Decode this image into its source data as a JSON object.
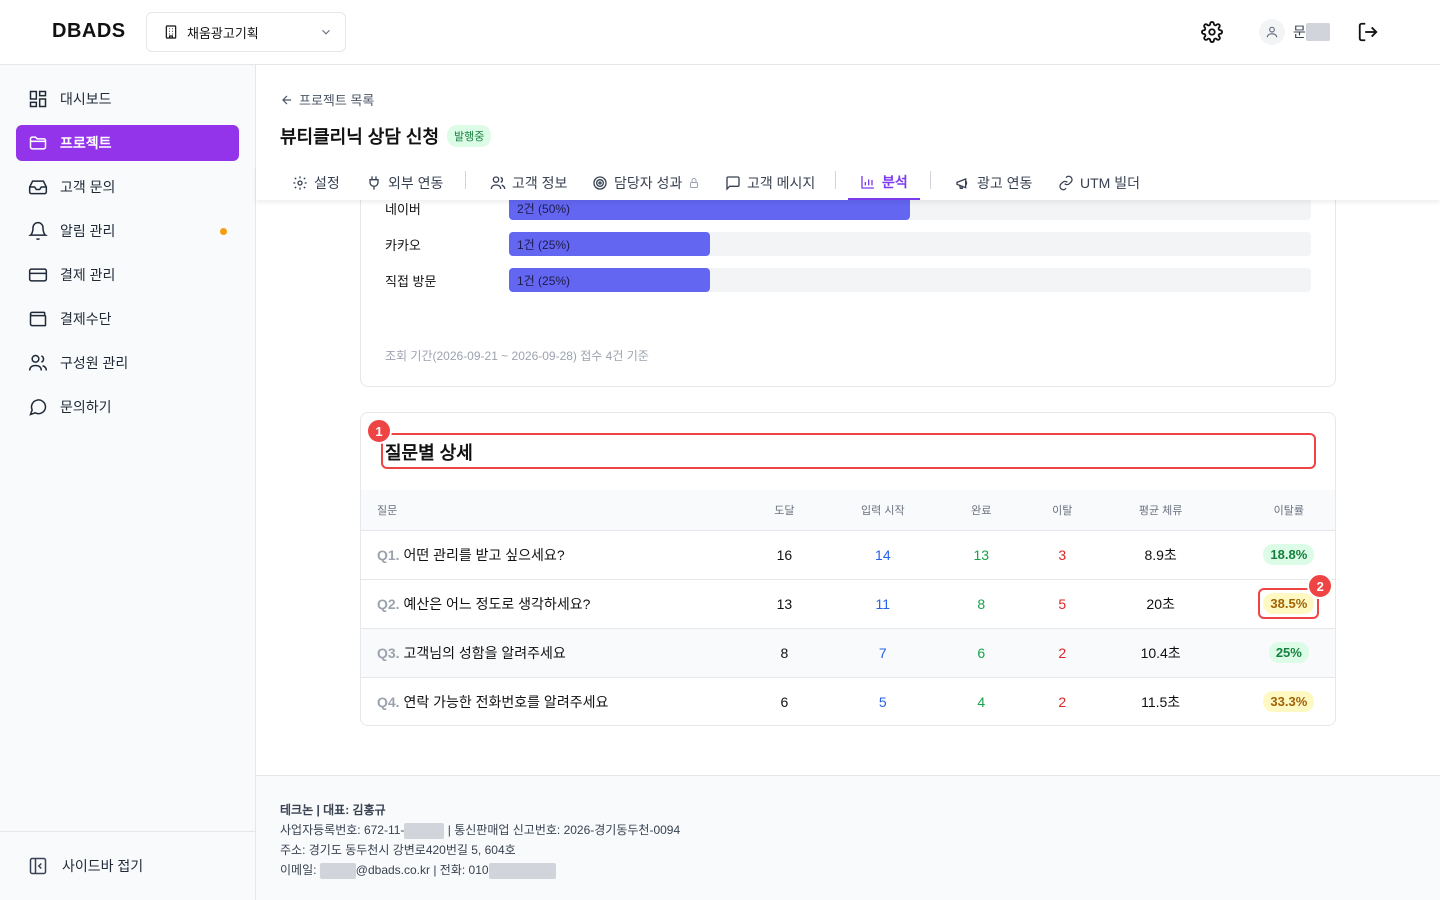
{
  "topbar": {
    "logo": "DBADS",
    "workspace": "채움광고기획",
    "user_name": "문"
  },
  "sidebar": {
    "items": [
      {
        "label": "대시보드",
        "icon": "dashboard-grid-icon"
      },
      {
        "label": "프로젝트",
        "icon": "folder-icon",
        "active": true
      },
      {
        "label": "고객 문의",
        "icon": "inbox-icon"
      },
      {
        "label": "알림 관리",
        "icon": "bell-icon",
        "notification_dot": true
      },
      {
        "label": "결제 관리",
        "icon": "credit-card-icon"
      },
      {
        "label": "결제수단",
        "icon": "wallet-icon"
      },
      {
        "label": "구성원 관리",
        "icon": "users-icon"
      },
      {
        "label": "문의하기",
        "icon": "message-circle-icon"
      }
    ],
    "collapse_label": "사이드바 접기"
  },
  "project": {
    "back_label": "프로젝트 목록",
    "title": "뷰티클리닉 상담 신청",
    "status": "발행중"
  },
  "tabs": [
    {
      "label": "설정",
      "icon": "gear-icon"
    },
    {
      "label": "외부 연동",
      "icon": "plug-icon"
    },
    {
      "label": "고객 정보",
      "icon": "users-icon"
    },
    {
      "label": "담당자 성과",
      "icon": "target-icon",
      "locked": true
    },
    {
      "label": "고객 메시지",
      "icon": "message-square-icon"
    },
    {
      "label": "분석",
      "icon": "bar-chart-icon",
      "active": true
    },
    {
      "label": "광고 연동",
      "icon": "megaphone-icon"
    },
    {
      "label": "UTM 빌더",
      "icon": "link-icon"
    }
  ],
  "inflow": {
    "rows": [
      {
        "label": "네이버",
        "value": "2건 (50%)",
        "fraction": 0.5
      },
      {
        "label": "카카오",
        "value": "1건 (25%)",
        "fraction": 0.25
      },
      {
        "label": "직접 방문",
        "value": "1건 (25%)",
        "fraction": 0.25
      }
    ],
    "note": "조회 기간(2026-09-21 ~ 2026-09-28) 접수 4건 기준"
  },
  "question_detail": {
    "title": "질문별 상세",
    "columns": [
      "질문",
      "도달",
      "입력 시작",
      "완료",
      "이탈",
      "평균 체류",
      "이탈률"
    ],
    "rows": [
      {
        "num": "Q1.",
        "text": "어떤 관리를 받고 싶으세요?",
        "reach": "16",
        "start": "14",
        "done": "13",
        "drop": "3",
        "avg": "8.9초",
        "rate": "18.8%",
        "level": "good"
      },
      {
        "num": "Q2.",
        "text": "예산은 어느 정도로 생각하세요?",
        "reach": "13",
        "start": "11",
        "done": "8",
        "drop": "5",
        "avg": "20초",
        "rate": "38.5%",
        "level": "warn"
      },
      {
        "num": "Q3.",
        "text": "고객님의 성함을 알려주세요",
        "reach": "8",
        "start": "7",
        "done": "6",
        "drop": "2",
        "avg": "10.4초",
        "rate": "25%",
        "level": "good"
      },
      {
        "num": "Q4.",
        "text": "연락 가능한 전화번호를 알려주세요",
        "reach": "6",
        "start": "5",
        "done": "4",
        "drop": "2",
        "avg": "11.5초",
        "rate": "33.3%",
        "level": "warn"
      }
    ]
  },
  "annotations": {
    "m1": "1",
    "m2": "2"
  },
  "footer": {
    "company": "테크논 | 대표: 김홍규",
    "biz_prefix": "사업자등록번호: 672-11-",
    "biz_suffix": " | 통신판매업 신고번호: 2026-경기동두천-0094",
    "address": "주소: 경기도 동두천시 강변로420번길 5, 604호",
    "email_prefix": "이메일: ",
    "email_suffix": "@dbads.co.kr | 전화: 010"
  },
  "colors": {
    "accent": "#9333ea",
    "bar": "#6366f1",
    "highlight": "#ef4444"
  }
}
